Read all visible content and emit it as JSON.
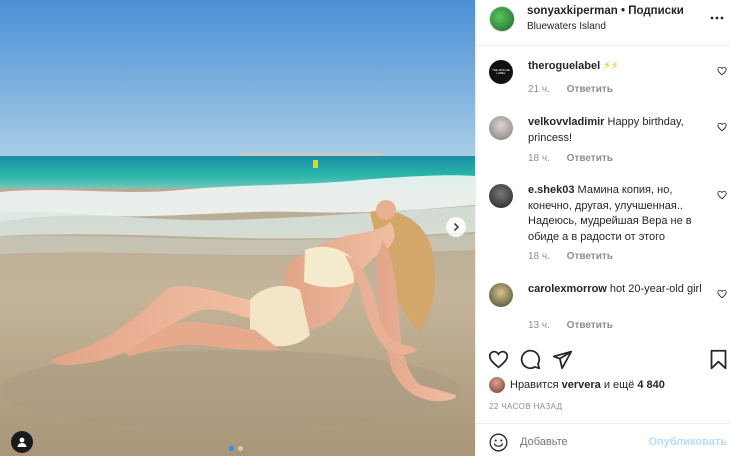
{
  "post_header": {
    "username": "sonyaxkiperman",
    "separator": "•",
    "follow_label": "Подписки",
    "location": "Bluewaters Island",
    "more_label": "•••"
  },
  "comments": [
    {
      "username": "theroguelabel",
      "text": " ⚡⚡",
      "time": "21 ч.",
      "reply": "Ответить",
      "avatar_text": "THE ROGUE LABEL"
    },
    {
      "username": "velkovvladimir",
      "text": " Happy birthday, princess!",
      "time": "18 ч.",
      "reply": "Ответить"
    },
    {
      "username": "e.shek03",
      "text": " Мамина копия, но, конечно, другая, улучшенная.. Надеюсь, мудрейшая Вера не в обиде а в радости от этого",
      "time": "18 ч.",
      "reply": "Ответить"
    },
    {
      "username": "carolexmorrow",
      "text": " hot 20-year-old girl",
      "time": "13 ч.",
      "reply": "Ответить"
    }
  ],
  "likes": {
    "prefix": "Нравится ",
    "user": "ververa",
    "middle": " и ещё ",
    "count": "4 840"
  },
  "timestamp": "22 ЧАСОВ НАЗАД",
  "add_comment": {
    "placeholder": "Добавьте",
    "publish_label": "Опубликовать"
  },
  "carousel": {
    "total": 2,
    "active": 1
  },
  "colors": {
    "sky_top": "#4a8fd6",
    "sea": "#1ea7a6",
    "sand": "#b8a78e",
    "link_disabled": "#b2dffc",
    "muted": "#8e8e8e"
  }
}
